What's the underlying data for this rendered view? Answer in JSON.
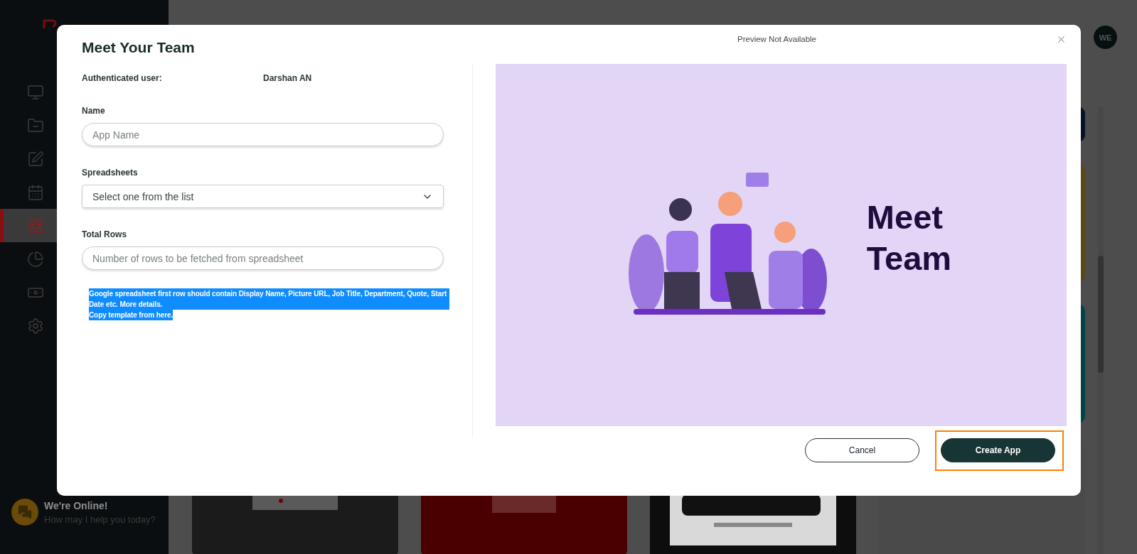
{
  "sidebar": {
    "items": [
      {
        "selected": false
      },
      {
        "selected": false
      },
      {
        "selected": false
      },
      {
        "selected": false
      },
      {
        "selected": true
      },
      {
        "selected": false
      },
      {
        "selected": false
      },
      {
        "selected": false
      }
    ],
    "chat": {
      "title": "We're Online!",
      "subtitle": "How may I help you today?"
    }
  },
  "header": {
    "avatar": "WE"
  },
  "side_cards": [
    {
      "color": "#07122a"
    },
    {
      "color": "#5a4818"
    },
    {
      "color": "#03434a"
    },
    {
      "color": "#4a4a4a"
    }
  ],
  "modal": {
    "title": "Meet Your Team",
    "preview_title": "Preview Not Available",
    "auth": {
      "label": "Authenticated user:",
      "value": "Darshan AN"
    },
    "fields": [
      {
        "label": "Name",
        "kind": "input",
        "placeholder": "App Name"
      },
      {
        "label": "Spreadsheets",
        "kind": "select",
        "placeholder": "Select one from the list"
      },
      {
        "label": "Total Rows",
        "kind": "input",
        "placeholder": "Number of rows to be fetched from spreadsheet"
      }
    ],
    "note": {
      "highlighted": true,
      "lines": [
        "Google spreadsheet first row should contain Display Name, Picture URL, Job Title, Department, Quote, Start Date etc. More details.",
        "Copy template from here."
      ]
    },
    "preview": {
      "kind": "picture",
      "heading": [
        "Meet",
        "Team"
      ]
    },
    "buttons": [
      {
        "label": "Cancel",
        "kind": "secondary",
        "highlighted": false
      },
      {
        "label": "Create App",
        "kind": "primary",
        "highlighted": true
      }
    ]
  }
}
